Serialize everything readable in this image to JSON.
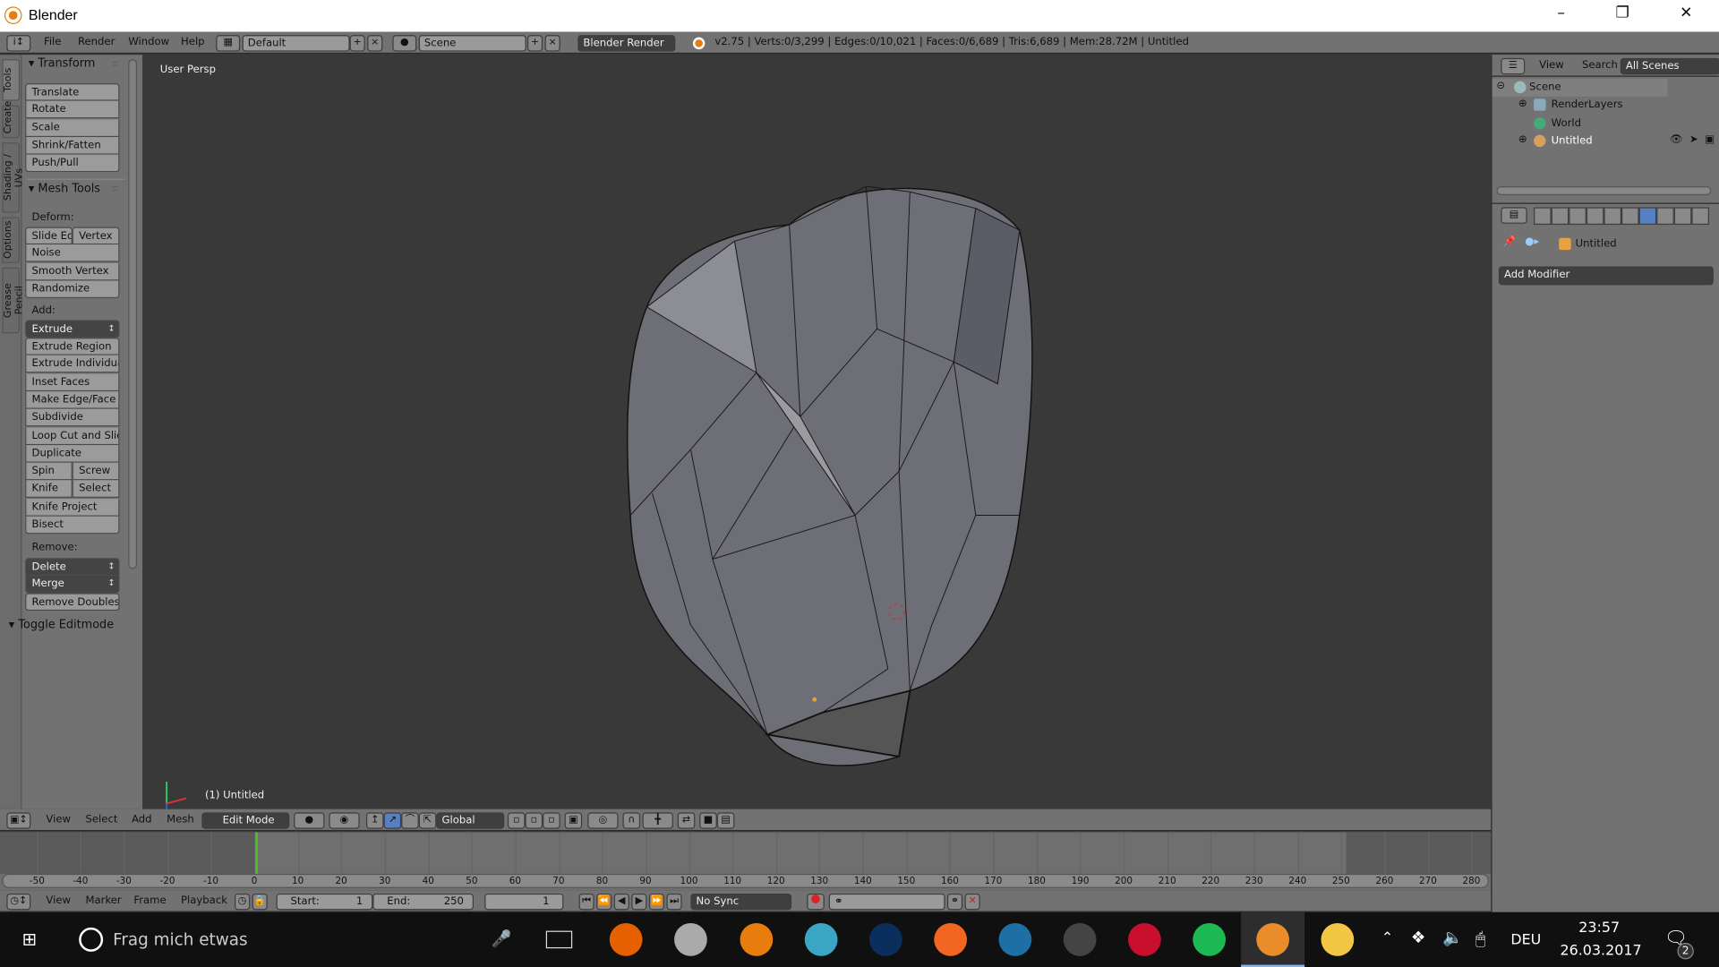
{
  "window": {
    "title": "Blender"
  },
  "info_header": {
    "menus": [
      "File",
      "Render",
      "Window",
      "Help"
    ],
    "layout": "Default",
    "scene": "Scene",
    "engine": "Blender Render",
    "stats": "v2.75 | Verts:0/3,299 | Edges:0/10,021 | Faces:0/6,689 | Tris:6,689 | Mem:28.72M | Untitled"
  },
  "tool_tabs": [
    "Tools",
    "Create",
    "Shading / UVs",
    "Options",
    "Grease Pencil"
  ],
  "tool_panel": {
    "transform_title": "Transform",
    "transform": [
      "Translate",
      "Rotate",
      "Scale",
      "Shrink/Fatten",
      "Push/Pull"
    ],
    "mesh_tools_title": "Mesh Tools",
    "deform_label": "Deform:",
    "deform": [
      [
        "Slide Ed",
        "Vertex"
      ],
      [
        "Noise"
      ],
      [
        "Smooth Vertex"
      ],
      [
        "Randomize"
      ]
    ],
    "add_label": "Add:",
    "add_dropdown": "Extrude",
    "add": [
      [
        "Extrude Region"
      ],
      [
        "Extrude Individual"
      ],
      [
        "Inset Faces"
      ],
      [
        "Make Edge/Face"
      ],
      [
        "Subdivide"
      ],
      [
        "Loop Cut and Slide"
      ],
      [
        "Duplicate"
      ],
      [
        "Spin",
        "Screw"
      ],
      [
        "Knife",
        "Select"
      ],
      [
        "Knife Project"
      ],
      [
        "Bisect"
      ]
    ],
    "remove_label": "Remove:",
    "remove_dropdowns": [
      "Delete",
      "Merge"
    ],
    "remove_doubles": "Remove Doubles",
    "toggle_editmode": "Toggle Editmode"
  },
  "viewport": {
    "view_label": "User Persp",
    "object_label": "(1) Untitled"
  },
  "view3d_header": {
    "menus": [
      "View",
      "Select",
      "Add",
      "Mesh"
    ],
    "mode": "Edit Mode",
    "orientation": "Global"
  },
  "timeline": {
    "ticks": [
      -50,
      -40,
      -30,
      -20,
      -10,
      0,
      10,
      20,
      30,
      40,
      50,
      60,
      70,
      80,
      90,
      100,
      110,
      120,
      130,
      140,
      150,
      160,
      170,
      180,
      190,
      200,
      210,
      220,
      230,
      240,
      250,
      260,
      270,
      280
    ],
    "current_frame": 1,
    "start_label": "Start:",
    "start": "1",
    "end_label": "End:",
    "end": "250",
    "frame": "1",
    "sync": "No Sync",
    "menus": [
      "View",
      "Marker",
      "Frame",
      "Playback"
    ]
  },
  "outliner": {
    "menus": [
      "View",
      "Search"
    ],
    "filter": "All Scenes",
    "items": [
      "Scene",
      "RenderLayers",
      "World",
      "Untitled"
    ]
  },
  "properties": {
    "context_object": "Untitled",
    "add_modifier": "Add Modifier",
    "active_tab": "modifiers"
  },
  "taskbar": {
    "search_placeholder": "Frag mich etwas",
    "language": "DEU",
    "time": "23:57",
    "date": "26.03.2017",
    "notifications": "2",
    "apps": [
      {
        "name": "firefox",
        "color": "#e66000"
      },
      {
        "name": "app-sphere",
        "color": "#aaaaaa"
      },
      {
        "name": "blender",
        "color": "#e87d0d"
      },
      {
        "name": "musescore",
        "color": "#3aa6c4"
      },
      {
        "name": "photoshop",
        "color": "#0a2f5c"
      },
      {
        "name": "origin",
        "color": "#f26522"
      },
      {
        "name": "steam-like",
        "color": "#1d6fa5"
      },
      {
        "name": "app-ring",
        "color": "#444444"
      },
      {
        "name": "app-red",
        "color": "#c8102e"
      },
      {
        "name": "spotify",
        "color": "#1db954"
      },
      {
        "name": "blender-active",
        "color": "#e87d0d"
      },
      {
        "name": "file-explorer",
        "color": "#f2c744"
      }
    ]
  },
  "colors": {
    "viewport_bg": "#393939",
    "panel_bg": "#727272",
    "accent_blue": "#5680c2",
    "frame_cursor": "#52c42a"
  }
}
